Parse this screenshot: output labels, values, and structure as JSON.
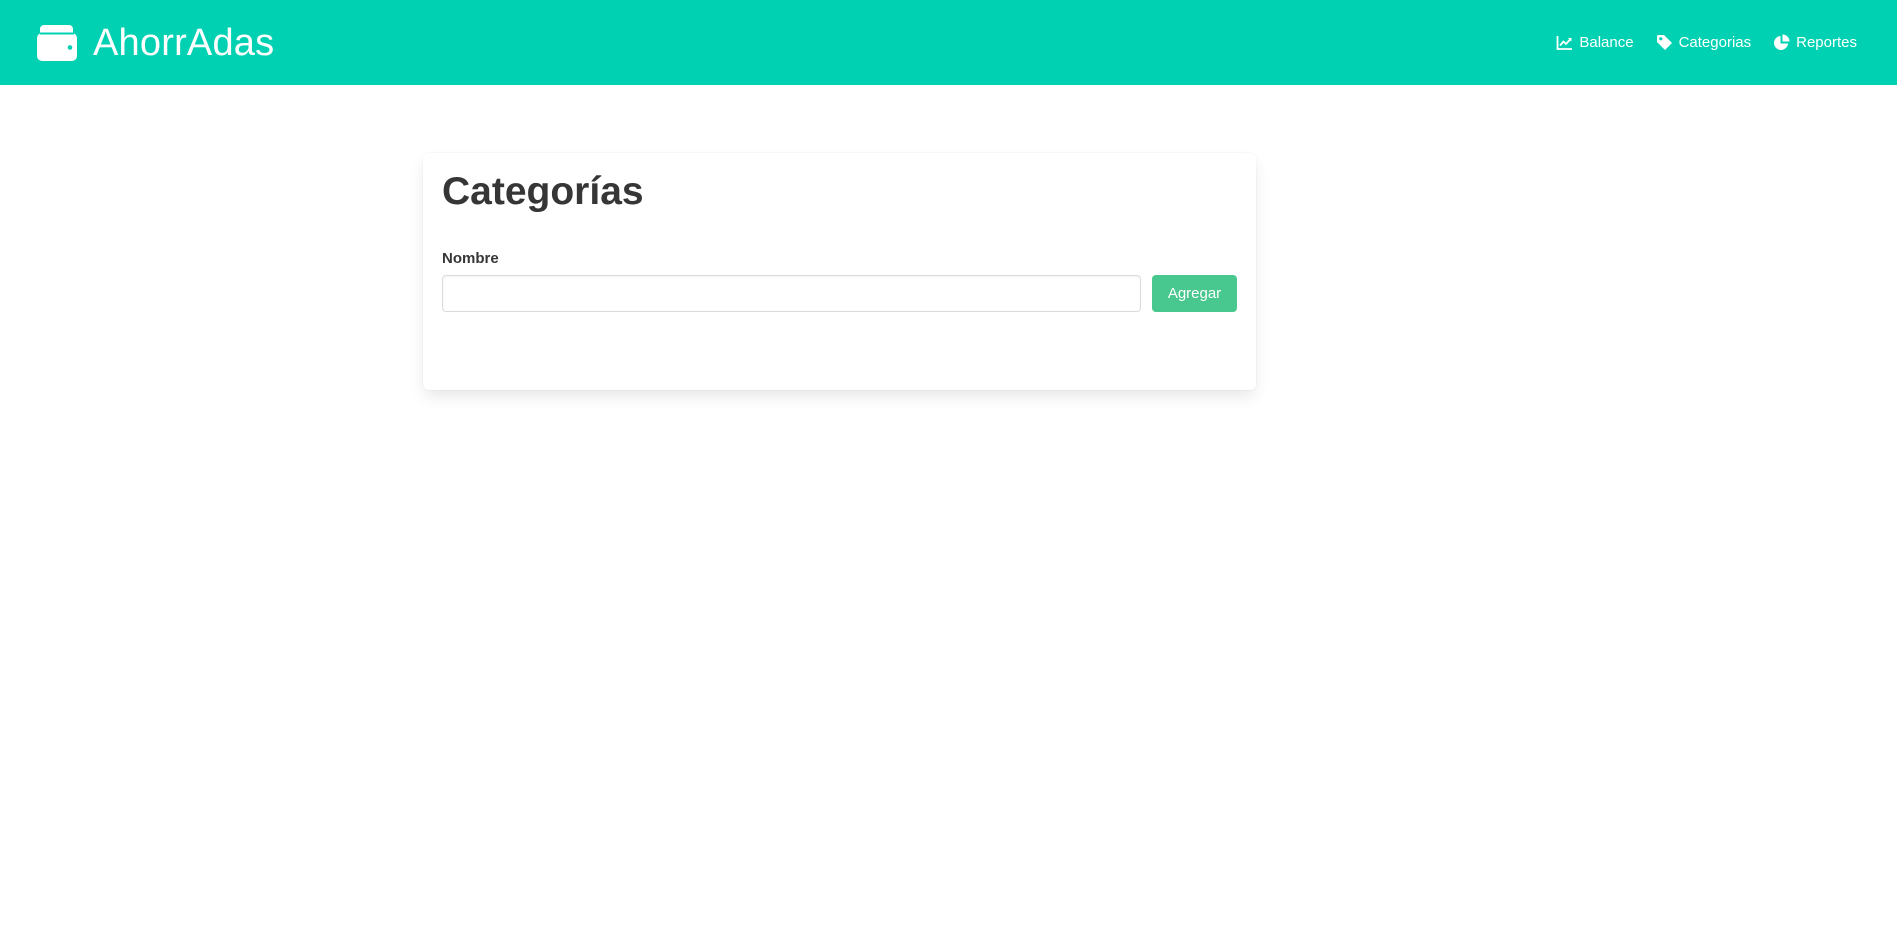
{
  "header": {
    "brand": {
      "name": "AhorrAdas",
      "icon": "wallet-icon"
    },
    "nav": [
      {
        "label": "Balance",
        "icon": "chart-line-icon"
      },
      {
        "label": "Categorias",
        "icon": "tag-icon"
      },
      {
        "label": "Reportes",
        "icon": "pie-chart-icon"
      }
    ],
    "background_color": "#00d1b2"
  },
  "main": {
    "title": "Categorías",
    "form": {
      "name_label": "Nombre",
      "name_value": "",
      "name_placeholder": "",
      "add_button_label": "Agregar",
      "add_button_color": "#48c78e"
    }
  }
}
